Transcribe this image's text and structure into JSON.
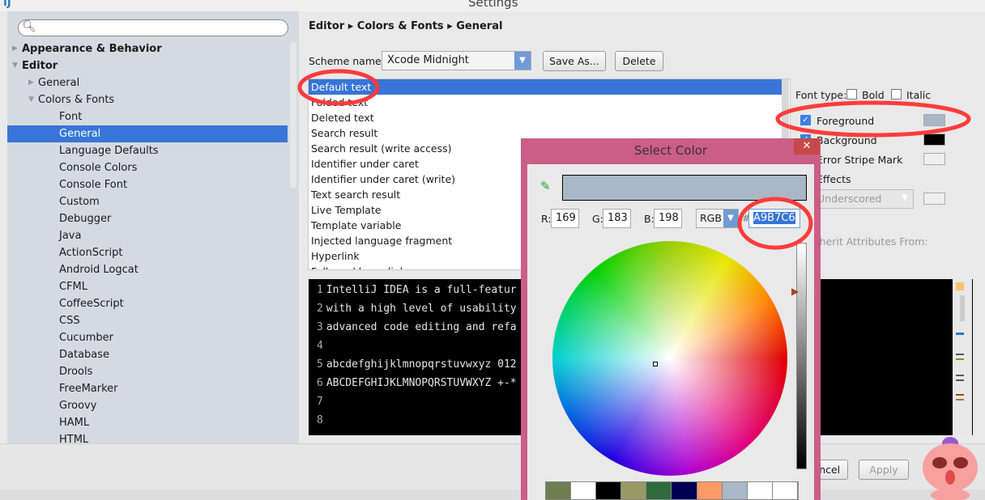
{
  "window": {
    "title": "Settings"
  },
  "sidebar": {
    "search_placeholder": "",
    "items": [
      {
        "label": "Appearance & Behavior",
        "level": 0,
        "bold": true,
        "expanded": false
      },
      {
        "label": "Editor",
        "level": 0,
        "bold": true,
        "expanded": true
      },
      {
        "label": "General",
        "level": 1,
        "expanded": false
      },
      {
        "label": "Colors & Fonts",
        "level": 1,
        "expanded": true
      },
      {
        "label": "Font",
        "level": 2
      },
      {
        "label": "General",
        "level": 2,
        "selected": true
      },
      {
        "label": "Language Defaults",
        "level": 2
      },
      {
        "label": "Console Colors",
        "level": 2
      },
      {
        "label": "Console Font",
        "level": 2
      },
      {
        "label": "Custom",
        "level": 2
      },
      {
        "label": "Debugger",
        "level": 2
      },
      {
        "label": "Java",
        "level": 2
      },
      {
        "label": "ActionScript",
        "level": 2
      },
      {
        "label": "Android Logcat",
        "level": 2
      },
      {
        "label": "CFML",
        "level": 2
      },
      {
        "label": "CoffeeScript",
        "level": 2
      },
      {
        "label": "CSS",
        "level": 2
      },
      {
        "label": "Cucumber",
        "level": 2
      },
      {
        "label": "Database",
        "level": 2
      },
      {
        "label": "Drools",
        "level": 2
      },
      {
        "label": "FreeMarker",
        "level": 2
      },
      {
        "label": "Groovy",
        "level": 2
      },
      {
        "label": "HAML",
        "level": 2
      },
      {
        "label": "HTML",
        "level": 2
      }
    ]
  },
  "main": {
    "breadcrumb": "Editor ▸ Colors & Fonts ▸ General",
    "scheme_label": "Scheme name:",
    "scheme_value": "Xcode Midnight",
    "save_as": "Save As...",
    "delete": "Delete",
    "list": [
      "Default text",
      "Folded text",
      "Deleted text",
      "Search result",
      "Search result (write access)",
      "Identifier under caret",
      "Identifier under caret (write)",
      "Text search result",
      "Live Template",
      "Template variable",
      "Injected language fragment",
      "Hyperlink",
      "Followed hyperlink"
    ],
    "preview": [
      {
        "n": "1",
        "t": "IntelliJ IDEA is a full-featur"
      },
      {
        "n": "2",
        "t": "with a high level of usability"
      },
      {
        "n": "3",
        "t": "advanced code editing and refa"
      },
      {
        "n": "4",
        "t": ""
      },
      {
        "n": "5",
        "t": "abcdefghijklmnopqrstuvwxyz 012"
      },
      {
        "n": "6",
        "t": "ABCDEFGHIJKLMNOPQRSTUVWXYZ +-*"
      },
      {
        "n": "7",
        "t": ""
      },
      {
        "n": "8",
        "t": ""
      }
    ],
    "props": {
      "font_type": "Font type:",
      "bold": "Bold",
      "italic": "Italic",
      "foreground": "Foreground",
      "foreground_color": "#a9b7c6",
      "background": "Background",
      "background_color": "#000000",
      "error_stripe": "Error Stripe Mark",
      "effects": "Effects",
      "effect_type": "Underscored",
      "inherit": "Inherit Attributes From:"
    }
  },
  "buttons": {
    "cancel": "Cancel",
    "apply": "Apply"
  },
  "dialog": {
    "title": "Select Color",
    "r_label": "R:",
    "r": "169",
    "g_label": "G:",
    "g": "183",
    "b_label": "B:",
    "b": "198",
    "mode": "RGB",
    "hex_label": "#",
    "hex": "A9B7C6",
    "current_color": "#a9b7c6",
    "swatches": [
      "#6e7d4e",
      "#ffffff",
      "#000000",
      "#999966",
      "#2f6b3f",
      "#000055",
      "#ff9966",
      "#a9b7c6",
      "#ffffff",
      "#ffffff"
    ]
  },
  "colors": {
    "selection": "#3875d7",
    "annotation": "#ff3b3b",
    "dialog_frame": "#cb5e84"
  }
}
